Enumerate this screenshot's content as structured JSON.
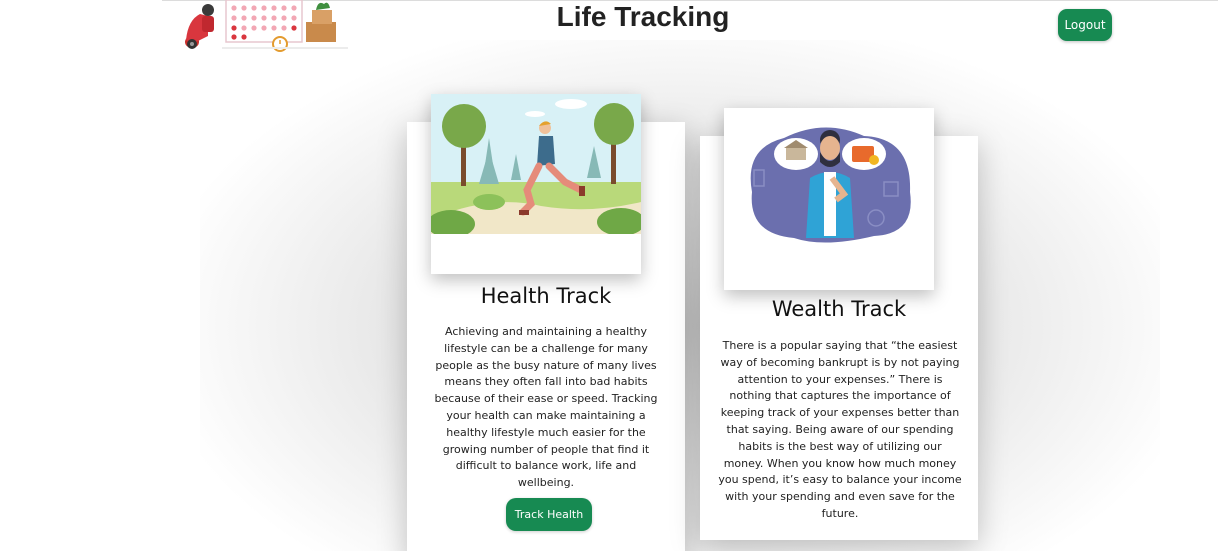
{
  "header": {
    "title": "Life Tracking",
    "logout_label": "Logout"
  },
  "health_card": {
    "title": "Health Track",
    "description": "Achieving and maintaining a healthy lifestyle can be a challenge for many people as the busy nature of many lives means they often fall into bad habits because of their ease or speed. Tracking your health can make maintaining a healthy lifestyle much easier for the growing number of people that find it difficult to balance work, life and wellbeing.",
    "button_label": "Track Health"
  },
  "wealth_card": {
    "title": "Wealth Track",
    "description": "There is a popular saying that “the easiest way of becoming bankrupt is by not paying attention to your expenses.” There is nothing that captures the importance of keeping track of your expenses better than that saying. Being aware of our spending habits is the best way of utilizing our money. When you know how much money you spend, it’s easy to balance your income with your spending and even save for the future."
  },
  "colors": {
    "accent": "#178a52",
    "title_text": "#222222"
  },
  "icons": {
    "logo": "calendar-scooter-logo",
    "health_image": "runner-park-illustration",
    "wealth_image": "man-thinking-finance-illustration"
  }
}
